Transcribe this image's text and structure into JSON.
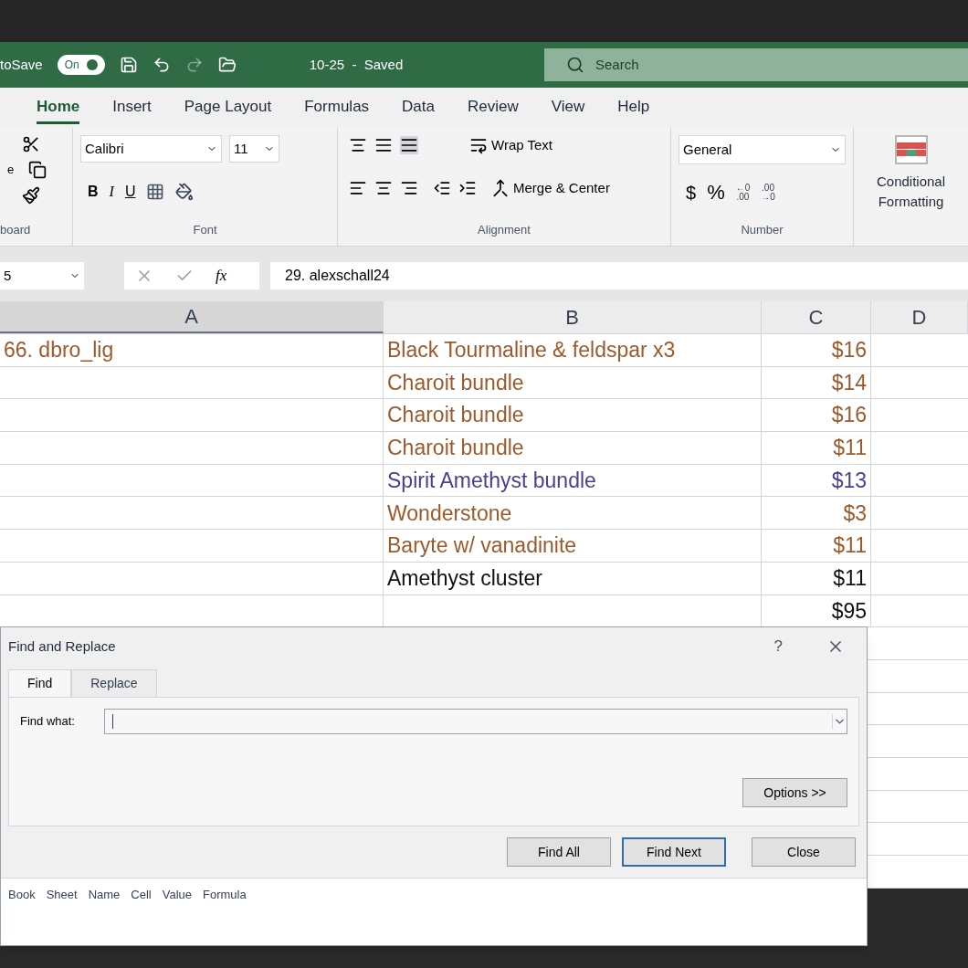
{
  "title_bar": {
    "autosave_label": "toSave",
    "autosave_toggle": {
      "label": "On",
      "on": true
    },
    "doc_title": "10-25  -  Saved",
    "search_placeholder": "Search"
  },
  "ribbon_tabs": [
    {
      "label": "Home",
      "selected": true
    },
    {
      "label": "Insert",
      "selected": false
    },
    {
      "label": "Page Layout",
      "selected": false
    },
    {
      "label": "Formulas",
      "selected": false
    },
    {
      "label": "Data",
      "selected": false
    },
    {
      "label": "Review",
      "selected": false
    },
    {
      "label": "View",
      "selected": false
    },
    {
      "label": "Help",
      "selected": false
    }
  ],
  "clipboard": {
    "paste_label": "e",
    "group_label": "board"
  },
  "font": {
    "name": "Calibri",
    "size": "11",
    "bold": "B",
    "italic": "I",
    "underline": "U",
    "group_label": "Font"
  },
  "alignment": {
    "wrap_text": "Wrap Text",
    "merge_center": "Merge & Center",
    "group_label": "Alignment"
  },
  "number": {
    "format": "General",
    "currency": "$",
    "percent": "%",
    "increase_decimal": [
      "←0",
      ".00"
    ],
    "decrease_decimal": [
      ".00",
      "→0"
    ],
    "group_label": "Number"
  },
  "styles": {
    "conditional_formatting": [
      "Conditional",
      "Formatting"
    ]
  },
  "formula_bar": {
    "name_box": "5",
    "fx": "fx",
    "value": "29. alexschall24"
  },
  "columns": [
    "A",
    "B",
    "C",
    "D"
  ],
  "rows": [
    {
      "a": "66. dbro_lig",
      "b": "Black Tourmaline & feldspar x3",
      "c": "$16",
      "color": "#9c5a2c"
    },
    {
      "b": "Charoit bundle",
      "c": "$14",
      "color": "#9c5a2c"
    },
    {
      "b": "Charoit bundle",
      "c": "$16",
      "color": "#9c5a2c"
    },
    {
      "b": "Charoit bundle",
      "c": "$11",
      "color": "#9c5a2c"
    },
    {
      "b": "Spirit Amethyst bundle",
      "c": "$13",
      "color": "#4b3f8f"
    },
    {
      "b": "Wonderstone",
      "c": "$3",
      "color": "#9c5a2c"
    },
    {
      "b": "Baryte w/ vanadinite",
      "c": "$11",
      "color": "#9c5a2c"
    },
    {
      "b": "Amethyst cluster",
      "c": "$11",
      "color": "#111111"
    },
    {
      "c": "$95",
      "color": "#111111"
    }
  ],
  "dialog": {
    "title": "Find and Replace",
    "help": "?",
    "tabs": [
      {
        "label": "Find",
        "selected": true
      },
      {
        "label": "Replace",
        "selected": false
      }
    ],
    "find_label": "Find what:",
    "options_button": "Options >>",
    "buttons": [
      {
        "label": "Find All",
        "focused": false
      },
      {
        "label": "Find Next",
        "focused": true
      },
      {
        "label": "Close",
        "focused": false
      }
    ],
    "result_columns": [
      "Book",
      "Sheet",
      "Name",
      "Cell",
      "Value",
      "Formula"
    ]
  }
}
